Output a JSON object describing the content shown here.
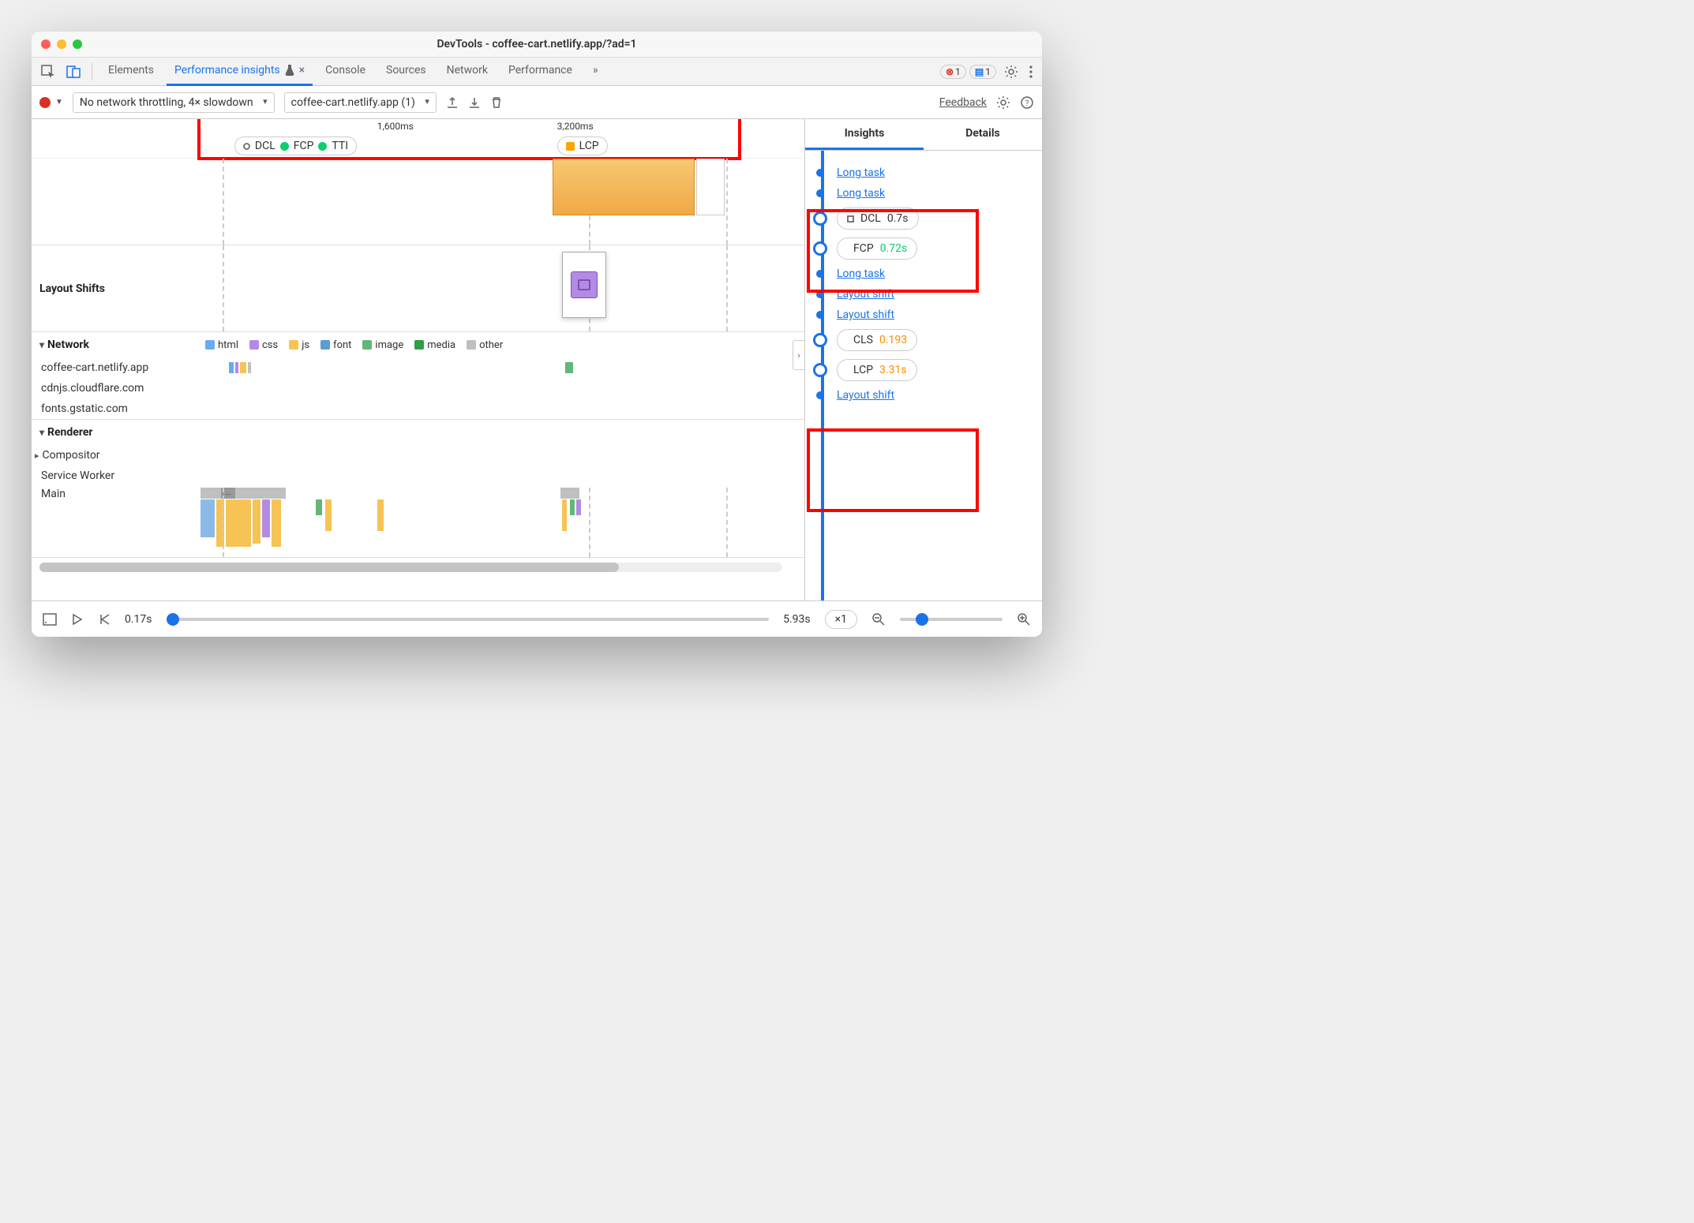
{
  "window": {
    "title": "DevTools - coffee-cart.netlify.app/?ad=1"
  },
  "tabs": {
    "items": [
      "Elements",
      "Performance insights",
      "Console",
      "Sources",
      "Network",
      "Performance"
    ],
    "active": "Performance insights",
    "more_icon": "»",
    "errors_count": "1",
    "messages_count": "1"
  },
  "toolbar": {
    "throttle": "No network throttling, 4× slowdown",
    "recording": "coffee-cart.netlify.app (1)",
    "feedback": "Feedback"
  },
  "ruler": {
    "marks": [
      {
        "label": "1,600ms",
        "leftPct": 34
      },
      {
        "label": "3,200ms",
        "leftPct": 68
      }
    ],
    "pill_groups": [
      {
        "leftPct": 7,
        "items": [
          {
            "dot": "hollow",
            "label": "DCL"
          },
          {
            "dot": "green",
            "label": "FCP"
          },
          {
            "dot": "green",
            "label": "TTI"
          }
        ]
      },
      {
        "leftPct": 68,
        "items": [
          {
            "dot": "sq",
            "label": "LCP"
          }
        ]
      }
    ]
  },
  "sections": {
    "layout_shifts": "Layout Shifts",
    "network": "Network",
    "renderer": "Renderer",
    "compositor": "Compositor",
    "service_worker": "Service Worker",
    "main": "Main"
  },
  "network_legend": [
    {
      "color": "#6aa9f4",
      "label": "html"
    },
    {
      "color": "#b48be4",
      "label": "css"
    },
    {
      "color": "#f5c454",
      "label": "js"
    },
    {
      "color": "#5b9bd5",
      "label": "font"
    },
    {
      "color": "#5fb878",
      "label": "image"
    },
    {
      "color": "#2f9e44",
      "label": "media"
    },
    {
      "color": "#c0c0c0",
      "label": "other"
    }
  ],
  "network_rows": [
    {
      "host": "coffee-cart.netlify.app"
    },
    {
      "host": "cdnjs.cloudflare.com"
    },
    {
      "host": "fonts.gstatic.com"
    }
  ],
  "insights": {
    "tabs": {
      "insights": "Insights",
      "details": "Details"
    },
    "items": [
      {
        "type": "link",
        "text": "Long task"
      },
      {
        "type": "link",
        "text": "Long task"
      },
      {
        "type": "metric",
        "dot": "hollow",
        "label": "DCL",
        "value": "0.7s",
        "valclass": ""
      },
      {
        "type": "metric",
        "dot": "green",
        "label": "FCP",
        "value": "0.72s",
        "valclass": "val-green"
      },
      {
        "type": "link",
        "text": "Long task"
      },
      {
        "type": "link",
        "text": "Layout shift"
      },
      {
        "type": "link",
        "text": "Layout shift"
      },
      {
        "type": "metric",
        "dot": "sq",
        "label": "CLS",
        "value": "0.193",
        "valclass": "val-orange"
      },
      {
        "type": "metric",
        "dot": "sq",
        "label": "LCP",
        "value": "3.31s",
        "valclass": "val-orange"
      },
      {
        "type": "link",
        "text": "Layout shift"
      }
    ]
  },
  "playbar": {
    "start": "0.17s",
    "end": "5.93s",
    "speed": "×1"
  }
}
